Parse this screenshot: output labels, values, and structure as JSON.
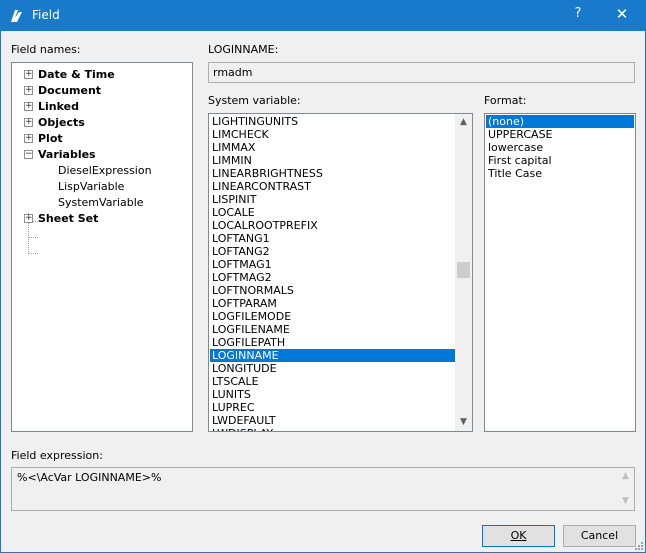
{
  "window": {
    "title": "Field",
    "help_glyph": "?",
    "close_glyph": "✕",
    "titlebar_color": "#1979ca"
  },
  "field_names": {
    "label": "Field names:",
    "items": [
      {
        "label": "Date & Time",
        "expander": "+"
      },
      {
        "label": "Document",
        "expander": "+"
      },
      {
        "label": "Linked",
        "expander": "+"
      },
      {
        "label": "Objects",
        "expander": "+"
      },
      {
        "label": "Plot",
        "expander": "+"
      },
      {
        "label": "Variables",
        "expander": "−"
      },
      {
        "label": "DieselExpression"
      },
      {
        "label": "LispVariable"
      },
      {
        "label": "SystemVariable"
      },
      {
        "label": "Sheet Set",
        "expander": "+"
      }
    ]
  },
  "value": {
    "label": "LOGINNAME:",
    "text": "rmadm"
  },
  "system_variable": {
    "label": "System variable:",
    "items": [
      "LIGHTINGUNITS",
      "LIMCHECK",
      "LIMMAX",
      "LIMMIN",
      "LINEARBRIGHTNESS",
      "LINEARCONTRAST",
      "LISPINIT",
      "LOCALE",
      "LOCALROOTPREFIX",
      "LOFTANG1",
      "LOFTANG2",
      "LOFTMAG1",
      "LOFTMAG2",
      "LOFTNORMALS",
      "LOFTPARAM",
      "LOGFILEMODE",
      "LOGFILENAME",
      "LOGFILEPATH",
      "LOGINNAME",
      "LONGITUDE",
      "LTSCALE",
      "LUNITS",
      "LUPREC",
      "LWDEFAULT",
      "LWDISPLAY"
    ],
    "selected": "LOGINNAME",
    "scroll_position": 0.49
  },
  "format": {
    "label": "Format:",
    "items": [
      "(none)",
      "UPPERCASE",
      "lowercase",
      "First capital",
      "Title Case"
    ],
    "selected": "(none)"
  },
  "expression": {
    "label": "Field expression:",
    "text": "%<\\AcVar LOGINNAME>%"
  },
  "buttons": {
    "ok": "OK",
    "cancel": "Cancel"
  },
  "icons": {
    "app": "bricscad-logo-icon",
    "scroll_up": "▲",
    "scroll_down": "▼"
  },
  "colors": {
    "selection": "#0078d7"
  }
}
